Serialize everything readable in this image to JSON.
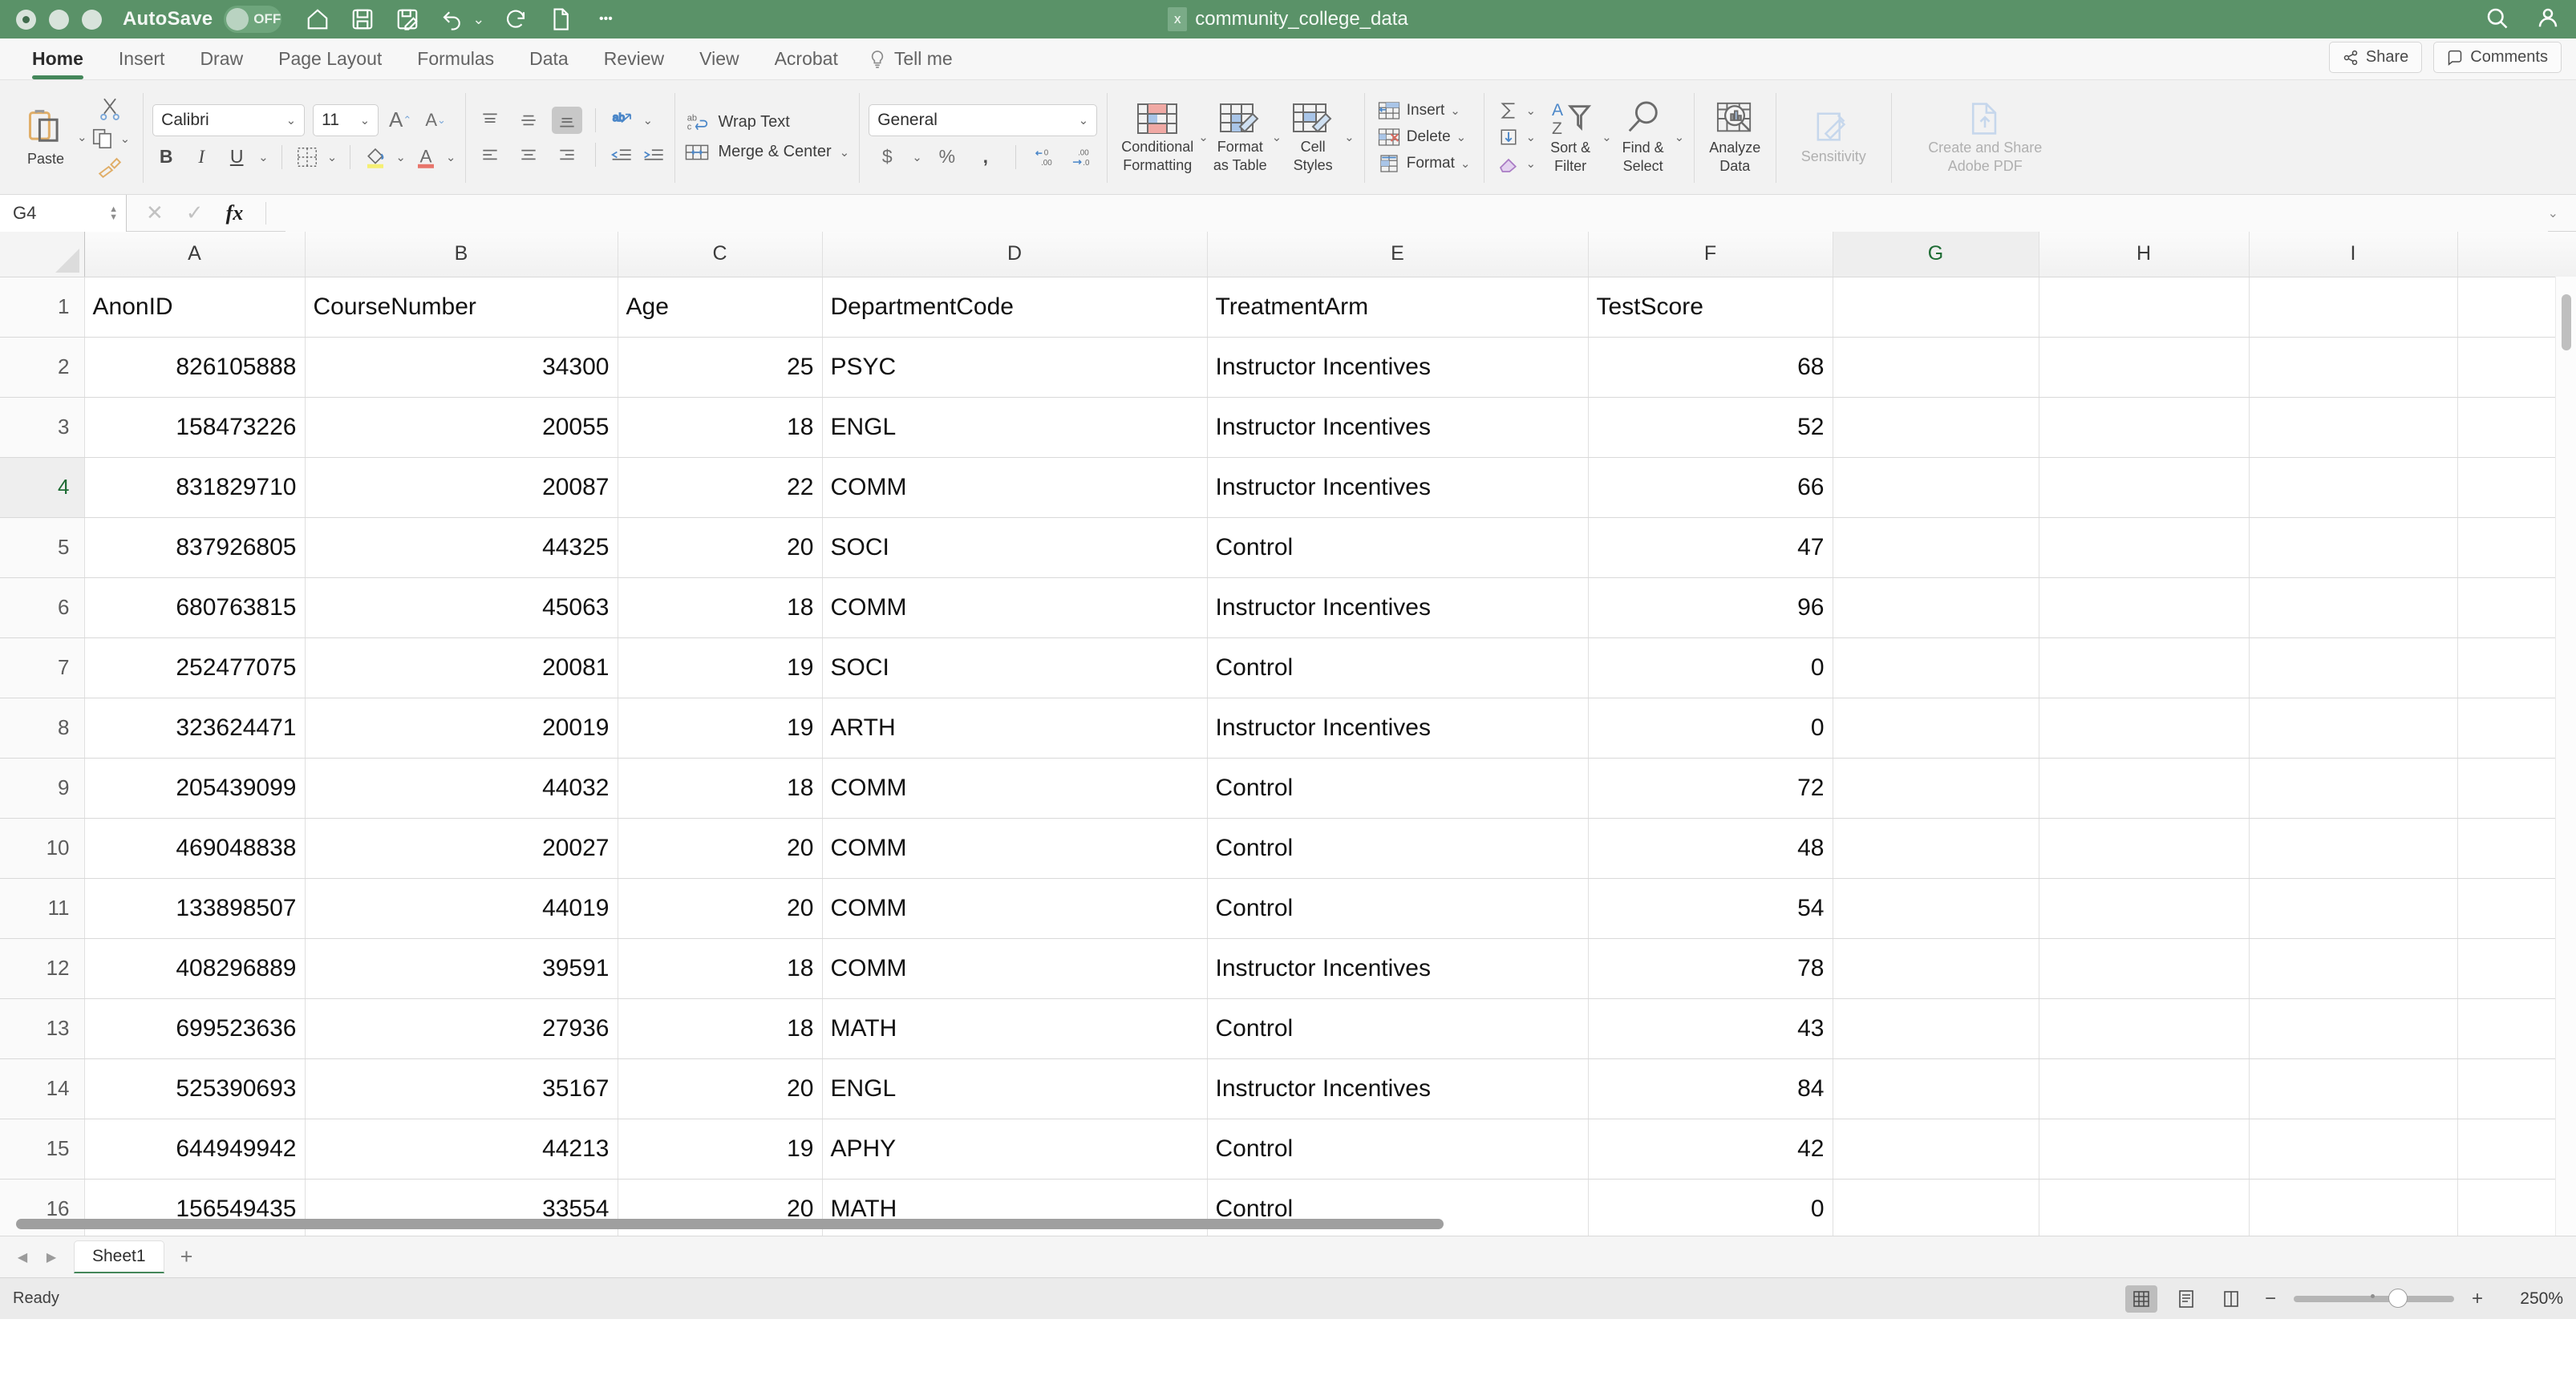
{
  "titlebar": {
    "autosave_label": "AutoSave",
    "autosave_state": "OFF",
    "document_title": "community_college_data",
    "quick_access": [
      "home-icon",
      "save-icon",
      "save-as-icon",
      "undo-icon",
      "redo-icon",
      "new-file-icon",
      "more-icon"
    ],
    "search_icon": "search-icon",
    "account_icon": "account-icon"
  },
  "tabs": {
    "items": [
      {
        "label": "Home",
        "active": true
      },
      {
        "label": "Insert",
        "active": false
      },
      {
        "label": "Draw",
        "active": false
      },
      {
        "label": "Page Layout",
        "active": false
      },
      {
        "label": "Formulas",
        "active": false
      },
      {
        "label": "Data",
        "active": false
      },
      {
        "label": "Review",
        "active": false
      },
      {
        "label": "View",
        "active": false
      },
      {
        "label": "Acrobat",
        "active": false
      }
    ],
    "tell_me": "Tell me",
    "share": "Share",
    "comments": "Comments"
  },
  "ribbon": {
    "paste": "Paste",
    "font_name": "Calibri",
    "font_size": "11",
    "grow_font": "A",
    "shrink_font": "A",
    "bold": "B",
    "italic": "I",
    "underline": "U",
    "wrap_text": "Wrap Text",
    "merge_center": "Merge & Center",
    "number_format": "General",
    "currency": "$",
    "percent": "%",
    "comma": ",",
    "conditional_formatting": "Conditional\nFormatting",
    "conditional_formatting_l1": "Conditional",
    "conditional_formatting_l2": "Formatting",
    "format_as_table_l1": "Format",
    "format_as_table_l2": "as Table",
    "cell_styles_l1": "Cell",
    "cell_styles_l2": "Styles",
    "insert": "Insert",
    "delete": "Delete",
    "format": "Format",
    "sort_filter_l1": "Sort &",
    "sort_filter_l2": "Filter",
    "find_select_l1": "Find &",
    "find_select_l2": "Select",
    "analyze_data_l1": "Analyze",
    "analyze_data_l2": "Data",
    "sensitivity": "Sensitivity",
    "adobe_l1": "Create and Share",
    "adobe_l2": "Adobe PDF"
  },
  "formula_bar": {
    "name_box": "G4",
    "cancel_icon": "close-icon",
    "confirm_icon": "check-icon",
    "function_icon": "fx",
    "formula_value": ""
  },
  "grid": {
    "column_headers": [
      "A",
      "B",
      "C",
      "D",
      "E",
      "F",
      "G",
      "H",
      "I"
    ],
    "selected_column": "G",
    "selected_row": "4",
    "row_numbers": [
      "1",
      "2",
      "3",
      "4",
      "5",
      "6",
      "7",
      "8",
      "9",
      "10",
      "11",
      "12",
      "13",
      "14",
      "15",
      "16"
    ],
    "header_row": [
      "AnonID",
      "CourseNumber",
      "Age",
      "DepartmentCode",
      "TreatmentArm",
      "TestScore"
    ],
    "rows": [
      {
        "row": "2",
        "AnonID": "826105888",
        "CourseNumber": "34300",
        "Age": "25",
        "DepartmentCode": "PSYC",
        "TreatmentArm": "Instructor Incentives",
        "TestScore": "68"
      },
      {
        "row": "3",
        "AnonID": "158473226",
        "CourseNumber": "20055",
        "Age": "18",
        "DepartmentCode": "ENGL",
        "TreatmentArm": "Instructor Incentives",
        "TestScore": "52"
      },
      {
        "row": "4",
        "AnonID": "831829710",
        "CourseNumber": "20087",
        "Age": "22",
        "DepartmentCode": "COMM",
        "TreatmentArm": "Instructor Incentives",
        "TestScore": "66"
      },
      {
        "row": "5",
        "AnonID": "837926805",
        "CourseNumber": "44325",
        "Age": "20",
        "DepartmentCode": "SOCI",
        "TreatmentArm": "Control",
        "TestScore": "47"
      },
      {
        "row": "6",
        "AnonID": "680763815",
        "CourseNumber": "45063",
        "Age": "18",
        "DepartmentCode": "COMM",
        "TreatmentArm": "Instructor Incentives",
        "TestScore": "96"
      },
      {
        "row": "7",
        "AnonID": "252477075",
        "CourseNumber": "20081",
        "Age": "19",
        "DepartmentCode": "SOCI",
        "TreatmentArm": "Control",
        "TestScore": "0"
      },
      {
        "row": "8",
        "AnonID": "323624471",
        "CourseNumber": "20019",
        "Age": "19",
        "DepartmentCode": "ARTH",
        "TreatmentArm": "Instructor Incentives",
        "TestScore": "0"
      },
      {
        "row": "9",
        "AnonID": "205439099",
        "CourseNumber": "44032",
        "Age": "18",
        "DepartmentCode": "COMM",
        "TreatmentArm": "Control",
        "TestScore": "72"
      },
      {
        "row": "10",
        "AnonID": "469048838",
        "CourseNumber": "20027",
        "Age": "20",
        "DepartmentCode": "COMM",
        "TreatmentArm": "Control",
        "TestScore": "48"
      },
      {
        "row": "11",
        "AnonID": "133898507",
        "CourseNumber": "44019",
        "Age": "20",
        "DepartmentCode": "COMM",
        "TreatmentArm": "Control",
        "TestScore": "54"
      },
      {
        "row": "12",
        "AnonID": "408296889",
        "CourseNumber": "39591",
        "Age": "18",
        "DepartmentCode": "COMM",
        "TreatmentArm": "Instructor Incentives",
        "TestScore": "78"
      },
      {
        "row": "13",
        "AnonID": "699523636",
        "CourseNumber": "27936",
        "Age": "18",
        "DepartmentCode": "MATH",
        "TreatmentArm": "Control",
        "TestScore": "43"
      },
      {
        "row": "14",
        "AnonID": "525390693",
        "CourseNumber": "35167",
        "Age": "20",
        "DepartmentCode": "ENGL",
        "TreatmentArm": "Instructor Incentives",
        "TestScore": "84"
      },
      {
        "row": "15",
        "AnonID": "644949942",
        "CourseNumber": "44213",
        "Age": "19",
        "DepartmentCode": "APHY",
        "TreatmentArm": "Control",
        "TestScore": "42"
      },
      {
        "row": "16",
        "AnonID": "156549435",
        "CourseNumber": "33554",
        "Age": "20",
        "DepartmentCode": "MATH",
        "TreatmentArm": "Control",
        "TestScore": "0"
      }
    ]
  },
  "sheet_bar": {
    "sheet_name": "Sheet1",
    "add_label": "+"
  },
  "status_bar": {
    "status": "Ready",
    "zoom": "250%",
    "views": [
      "normal-view-icon",
      "page-layout-icon",
      "page-break-icon"
    ]
  },
  "colors": {
    "titlebar_green": "#5a9268",
    "accent_green": "#44875a",
    "selection_green": "#1d6b33"
  }
}
